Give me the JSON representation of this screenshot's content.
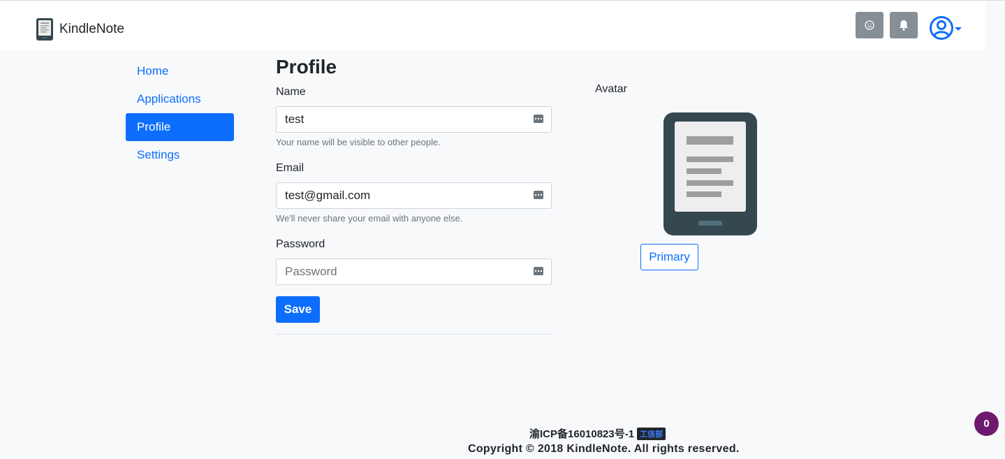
{
  "navbar": {
    "brand": "KindleNote",
    "icons": [
      "smile-icon",
      "bell-icon",
      "user-avatar-icon"
    ]
  },
  "sidebar": {
    "items": [
      {
        "label": "Home",
        "active": false
      },
      {
        "label": "Applications",
        "active": false
      },
      {
        "label": "Profile",
        "active": true
      },
      {
        "label": "Settings",
        "active": false
      }
    ]
  },
  "main": {
    "title": "Profile",
    "name": {
      "label": "Name",
      "value": "test",
      "help": "Your name will be visible to other people."
    },
    "email": {
      "label": "Email",
      "value": "test@gmail.com",
      "help": "We'll never share your email with anyone else."
    },
    "password": {
      "label": "Password",
      "value": "",
      "placeholder": "Password"
    },
    "save_label": "Save"
  },
  "avatar": {
    "label": "Avatar",
    "button_label": "Primary"
  },
  "footer": {
    "icp": "渝ICP备16010823号-1",
    "icp_badge": "工信部",
    "copyright": "Copyright © 2018 KindleNote. All rights reserved."
  },
  "counter_badge": "0",
  "colors": {
    "primary": "#0d6efd",
    "nav_button": "#868e96",
    "counter": "#6e1a6e"
  }
}
